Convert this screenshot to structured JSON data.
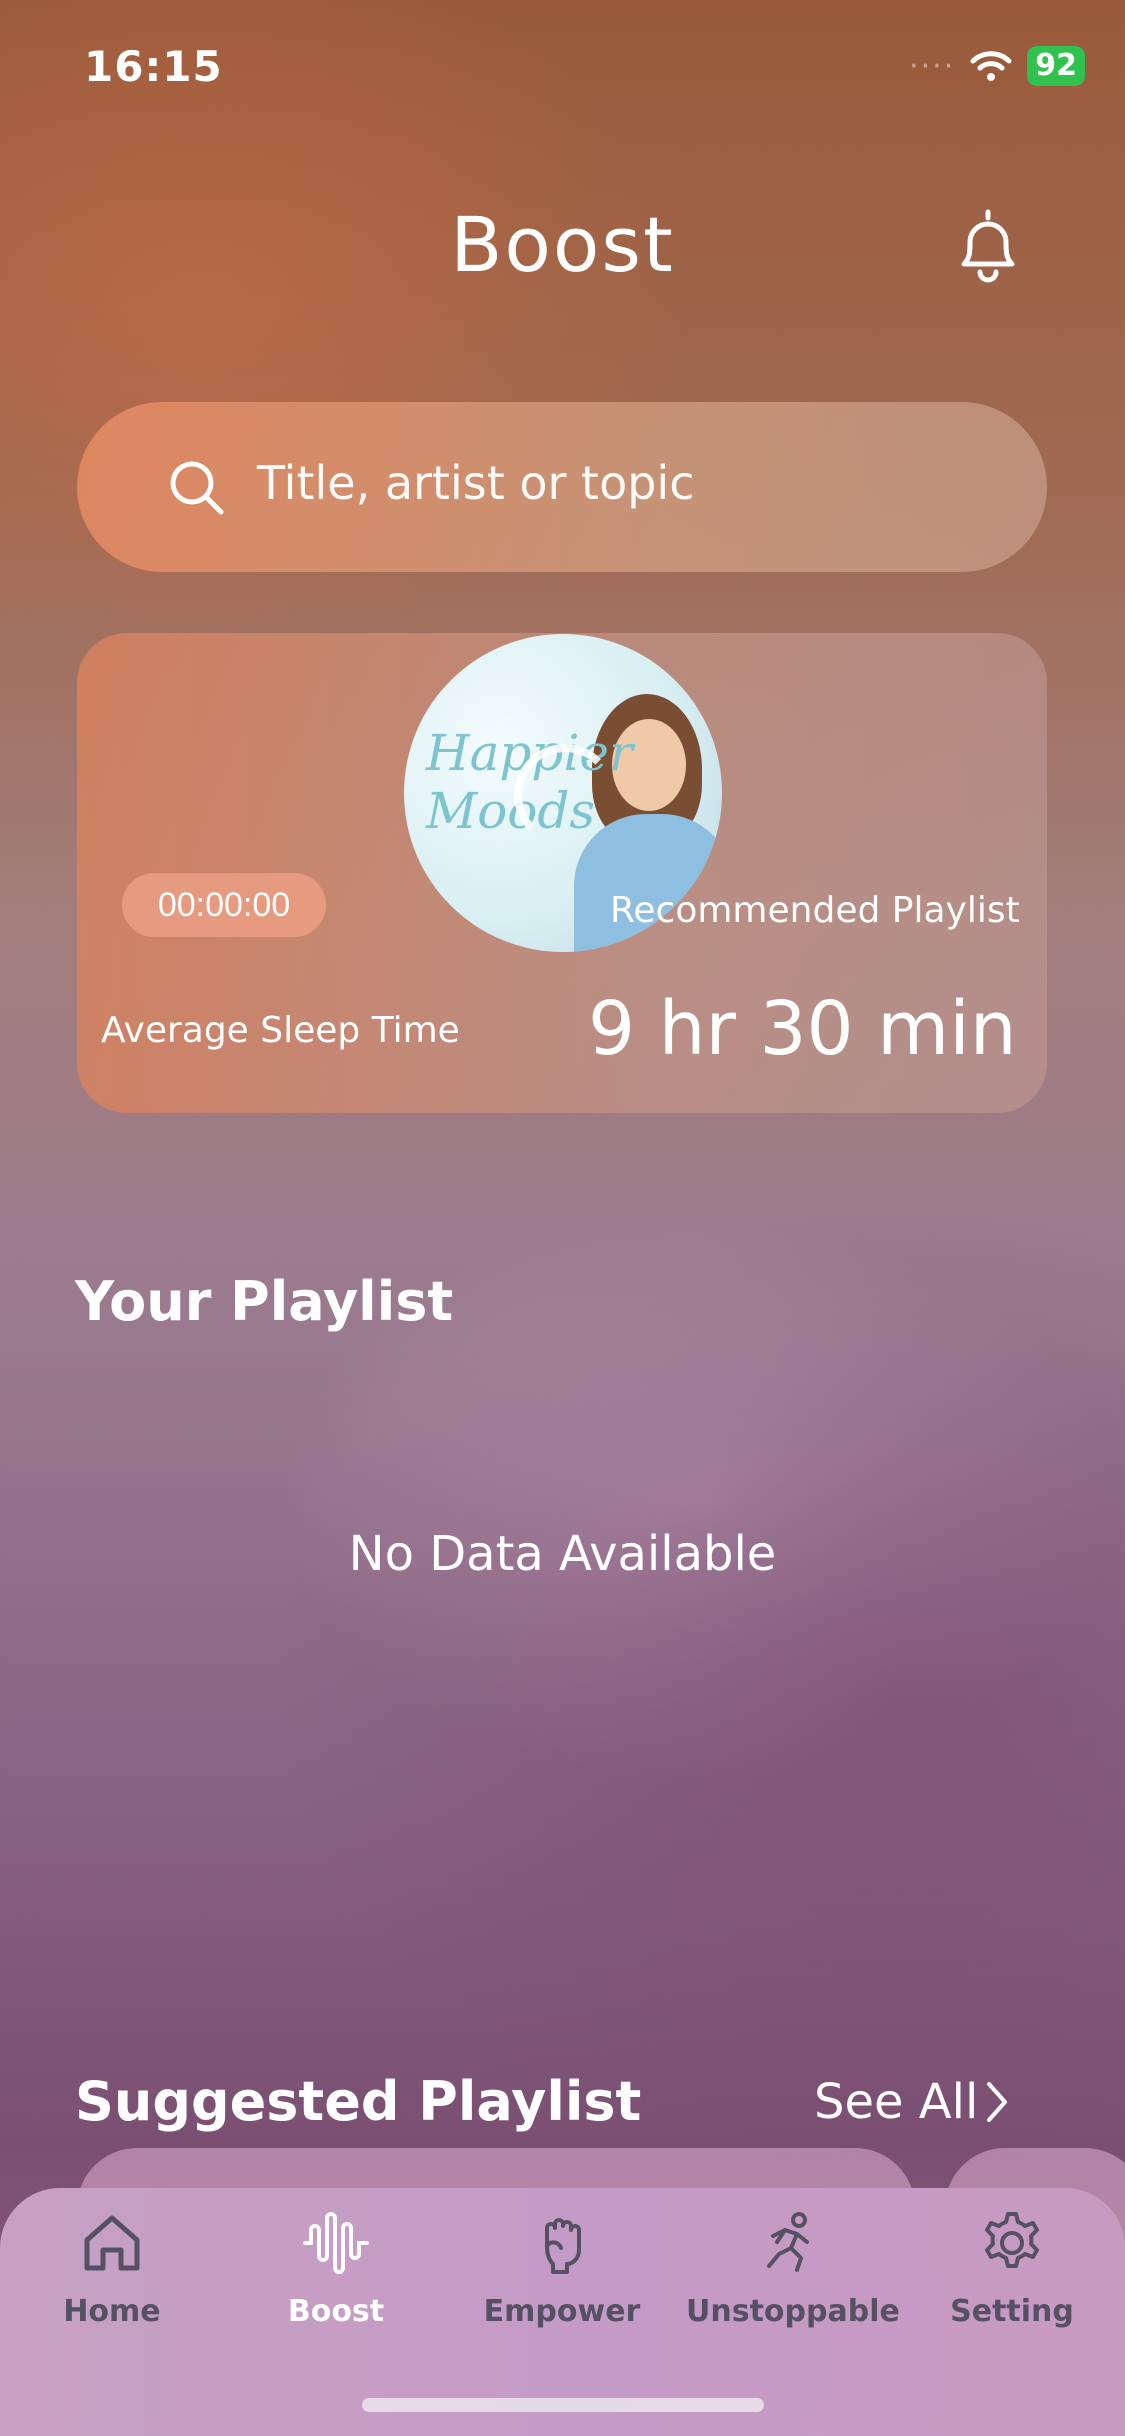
{
  "status": {
    "time": "16:15",
    "battery": "92"
  },
  "header": {
    "title": "Boost"
  },
  "search": {
    "placeholder": "Title, artist or topic"
  },
  "sleep_card": {
    "timer": "00:00:00",
    "album_text": "Happier Moods",
    "recommended_label": "Recommended Playlist",
    "average_label": "Average Sleep Time",
    "average_value": "9 hr 30 min"
  },
  "your_playlist": {
    "title": "Your Playlist",
    "empty_text": "No Data Available"
  },
  "suggested": {
    "title": "Suggested Playlist",
    "see_all": "See All"
  },
  "tabs": [
    {
      "label": "Home",
      "icon": "home-icon"
    },
    {
      "label": "Boost",
      "icon": "waveform-icon",
      "active": true
    },
    {
      "label": "Empower",
      "icon": "fist-icon"
    },
    {
      "label": "Unstoppable",
      "icon": "runner-icon"
    },
    {
      "label": "Setting",
      "icon": "gear-icon"
    }
  ],
  "colors": {
    "active_tab": "#ffffff",
    "inactive_tab": "#555062",
    "timer_bg": "#e69b80",
    "battery": "#31c14f"
  }
}
